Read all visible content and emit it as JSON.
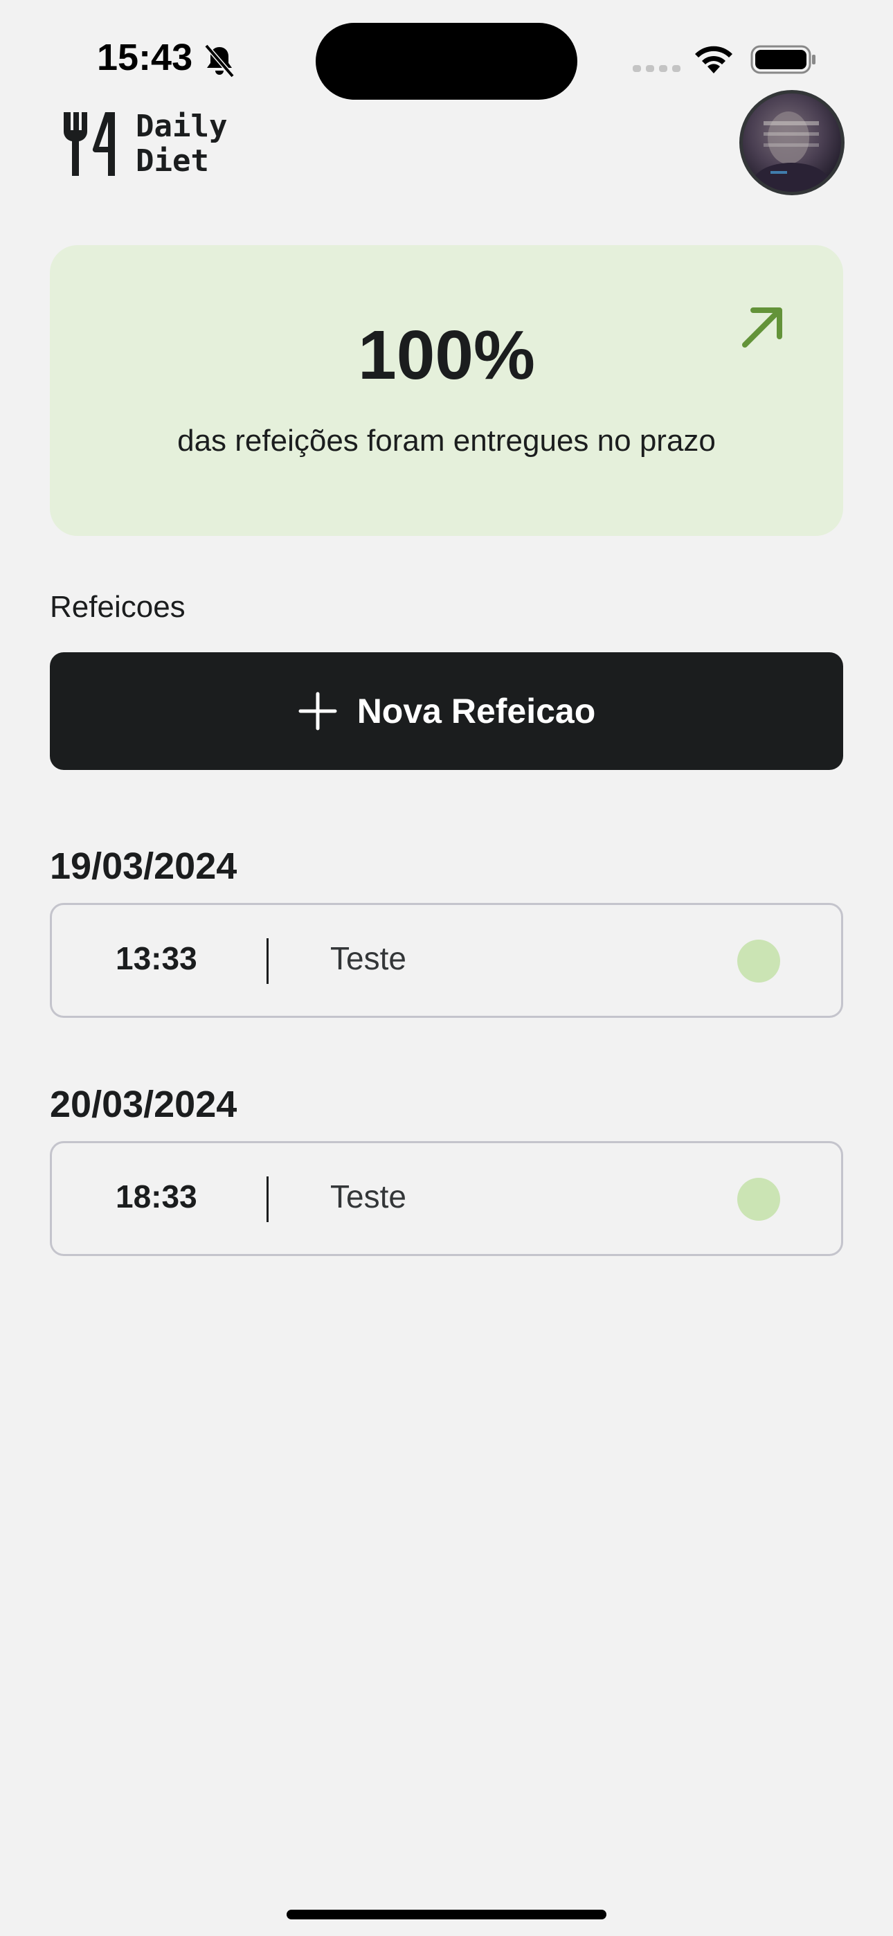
{
  "status_bar": {
    "time": "15:43",
    "bell_icon": "bell-slash-icon",
    "wifi_icon": "wifi-icon",
    "battery_icon": "battery-full-icon"
  },
  "header": {
    "logo_line1": "Daily",
    "logo_line2": "Diet",
    "logo_icon": "fork-knife-icon",
    "avatar": "user-avatar"
  },
  "stats": {
    "percent": "100%",
    "caption": "das refeições foram entregues no prazo",
    "arrow_icon": "arrow-up-right-icon",
    "accent": "#639339",
    "background": "#e5f0db"
  },
  "meals_section": {
    "label": "Refeicoes",
    "new_button_label": "Nova Refeicao"
  },
  "days": [
    {
      "date": "19/03/2024",
      "meals": [
        {
          "time": "13:33",
          "name": "Teste",
          "status_color": "#cbe4b4"
        }
      ]
    },
    {
      "date": "20/03/2024",
      "meals": [
        {
          "time": "18:33",
          "name": "Teste",
          "status_color": "#cbe4b4"
        }
      ]
    }
  ]
}
